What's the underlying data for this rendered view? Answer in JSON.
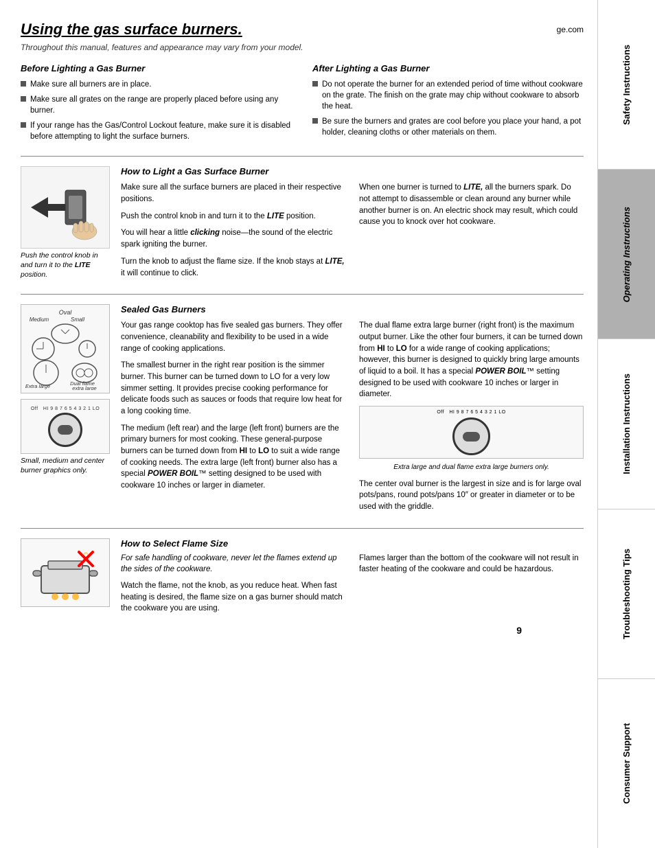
{
  "page": {
    "title": "Using the gas surface burners.",
    "website": "ge.com",
    "subtitle": "Throughout this manual, features and appearance may vary from your model.",
    "page_number": "9"
  },
  "sidebar": {
    "sections": [
      {
        "id": "safety",
        "label": "Safety Instructions",
        "highlighted": false
      },
      {
        "id": "operating",
        "label": "Operating Instructions",
        "highlighted": true
      },
      {
        "id": "installation",
        "label": "Installation Instructions",
        "highlighted": false
      },
      {
        "id": "troubleshooting",
        "label": "Troubleshooting Tips",
        "highlighted": false
      },
      {
        "id": "consumer",
        "label": "Consumer Support",
        "highlighted": false
      }
    ]
  },
  "before_lighting": {
    "heading": "Before Lighting a Gas Burner",
    "bullets": [
      "Make sure all burners are in place.",
      "Make sure all grates on the range are properly placed before using any burner.",
      "If your range has the Gas/Control Lockout feature, make sure it is disabled before attempting to light the surface burners."
    ]
  },
  "after_lighting": {
    "heading": "After Lighting a Gas Burner",
    "bullets": [
      "Do not operate the burner for an extended period of time without cookware on the grate. The finish on the grate may chip without cookware to absorb the heat.",
      "Be sure the burners and grates are cool before you place your hand, a pot holder, cleaning cloths or other materials on them."
    ]
  },
  "how_to_light": {
    "heading": "How to Light a Gas Surface Burner",
    "image_caption": "Push the control knob in and turn it to the LITE position.",
    "left_paragraphs": [
      "Make sure all the surface burners are placed in their respective positions.",
      "Push the control knob in and turn it to the LITE position.",
      "You will hear a little clicking noise—the sound of the electric spark igniting the burner.",
      "Turn the knob to adjust the flame size. If the knob stays at LITE, it will continue to click."
    ],
    "right_paragraph": "When one burner is turned to LITE, all the burners spark. Do not attempt to disassemble or clean around any burner while another burner is on. An electric shock may result, which could cause you to knock over hot cookware."
  },
  "sealed_burners": {
    "heading": "Sealed Gas Burners",
    "diagram_labels": {
      "oval": "Oval",
      "medium": "Medium",
      "small": "Small",
      "extra_large": "Extra large",
      "dual_flame": "Dual flame extra large"
    },
    "knob_caption": "Small, medium and center burner graphics only.",
    "left_paragraphs": [
      "Your gas range cooktop has five sealed gas burners. They offer convenience, cleanability and flexibility to be used in a wide range of cooking applications.",
      "The smallest burner in the right rear position is the simmer burner. This burner can be turned down to LO for a very low simmer setting. It provides precise cooking performance for delicate foods such as sauces or foods that require low heat for a long cooking time.",
      "The medium (left rear) and the large (left front) burners are the primary burners for most cooking. These general-purpose burners can be turned down from HI to LO to suit a wide range of cooking needs. The extra large (left front) burner also has a special POWER BOIL™ setting designed to be used with cookware 10 inches or larger in diameter."
    ],
    "right_paragraphs": [
      "The dual flame extra large burner (right front) is the maximum output burner. Like the other four burners, it can be turned down from HI to LO for a wide range of cooking applications; however, this burner is designed to quickly bring large amounts of liquid to a boil. It has a special POWER BOIL™ setting designed to be used with cookware 10 inches or larger in diameter.",
      "Extra large and dual flame extra large burners only.",
      "The center oval burner is the largest in size and is for large oval pots/pans, round pots/pans 10″ or greater in diameter or to be used with the griddle."
    ]
  },
  "flame_size": {
    "heading": "How to Select Flame Size",
    "left_paragraphs": [
      "For safe handling of cookware, never let the flames extend up the sides of the cookware.",
      "Watch the flame, not the knob, as you reduce heat. When fast heating is desired, the flame size on a gas burner should match the cookware you are using."
    ],
    "right_paragraph": "Flames larger than the bottom of the cookware will not result in faster heating of the cookware and could be hazardous."
  }
}
